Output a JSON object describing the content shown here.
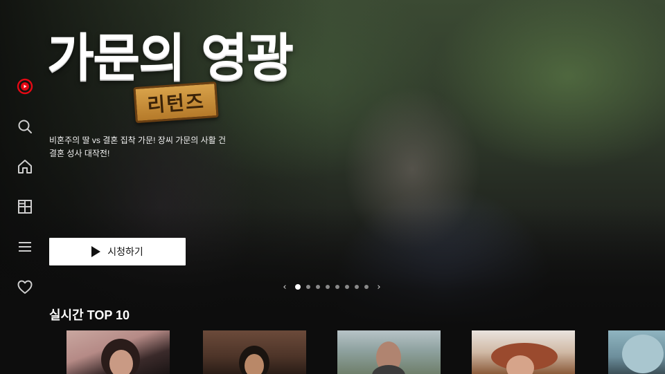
{
  "sidebar": {
    "items": [
      {
        "name": "logo",
        "icon": "play-logo-icon",
        "color": "#e50914"
      },
      {
        "name": "search",
        "icon": "search-icon"
      },
      {
        "name": "home",
        "icon": "home-icon"
      },
      {
        "name": "category",
        "icon": "grid-icon"
      },
      {
        "name": "menu",
        "icon": "menu-icon"
      },
      {
        "name": "favorites",
        "icon": "heart-icon"
      }
    ]
  },
  "hero": {
    "title": "가문의 영광",
    "subtitle_badge": "리턴즈",
    "description_line1": "비혼주의 딸 vs 결혼 집착 가문! 장씨 가문의 사활 건",
    "description_line2": "결혼 성사 대작전!",
    "watch_button": "시청하기"
  },
  "pager": {
    "prev": "‹",
    "next": "›",
    "total": 8,
    "active_index": 0
  },
  "section": {
    "title": "실시간 TOP 10"
  }
}
